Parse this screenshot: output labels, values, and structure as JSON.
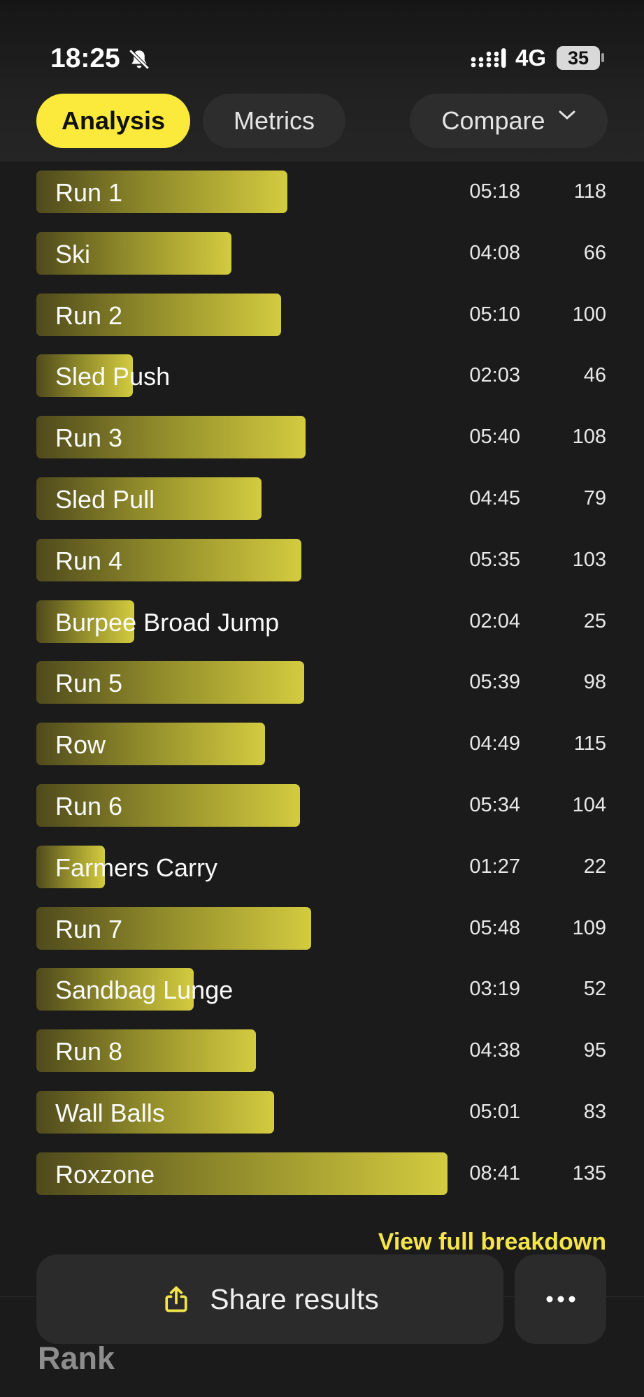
{
  "status": {
    "time": "18:25",
    "network": "4G",
    "battery": "35"
  },
  "tabs": [
    {
      "label": "Analysis",
      "active": true
    },
    {
      "label": "Metrics",
      "active": false
    },
    {
      "label": "Compare",
      "active": false
    }
  ],
  "stations": [
    {
      "name": "Run 1",
      "time": "05:18",
      "score": "118",
      "level": 0.61
    },
    {
      "name": "Ski",
      "time": "04:08",
      "score": "66",
      "level": 0.475
    },
    {
      "name": "Run 2",
      "time": "05:10",
      "score": "100",
      "level": 0.596
    },
    {
      "name": "Sled Push",
      "time": "02:03",
      "score": "46",
      "level": 0.234
    },
    {
      "name": "Run 3",
      "time": "05:40",
      "score": "108",
      "level": 0.654
    },
    {
      "name": "Sled Pull",
      "time": "04:45",
      "score": "79",
      "level": 0.547
    },
    {
      "name": "Run 4",
      "time": "05:35",
      "score": "103",
      "level": 0.645
    },
    {
      "name": "Burpee Broad Jump",
      "time": "02:04",
      "score": "25",
      "level": 0.238
    },
    {
      "name": "Run 5",
      "time": "05:39",
      "score": "98",
      "level": 0.651
    },
    {
      "name": "Row",
      "time": "04:49",
      "score": "115",
      "level": 0.556
    },
    {
      "name": "Run 6",
      "time": "05:34",
      "score": "104",
      "level": 0.642
    },
    {
      "name": "Farmers Carry",
      "time": "01:27",
      "score": "22",
      "level": 0.167
    },
    {
      "name": "Run 7",
      "time": "05:48",
      "score": "109",
      "level": 0.668
    },
    {
      "name": "Sandbag Lunge",
      "time": "03:19",
      "score": "52",
      "level": 0.382
    },
    {
      "name": "Run 8",
      "time": "04:38",
      "score": "95",
      "level": 0.534
    },
    {
      "name": "Wall Balls",
      "time": "05:01",
      "score": "83",
      "level": 0.578
    },
    {
      "name": "Roxzone",
      "time": "08:41",
      "score": "135",
      "level": 1.0
    }
  ],
  "view_full_label": "View full breakdown",
  "share_label": "Share results",
  "rank_label": "Rank",
  "colors": {
    "accent": "#fbea3b",
    "background": "#1b1b1b"
  }
}
